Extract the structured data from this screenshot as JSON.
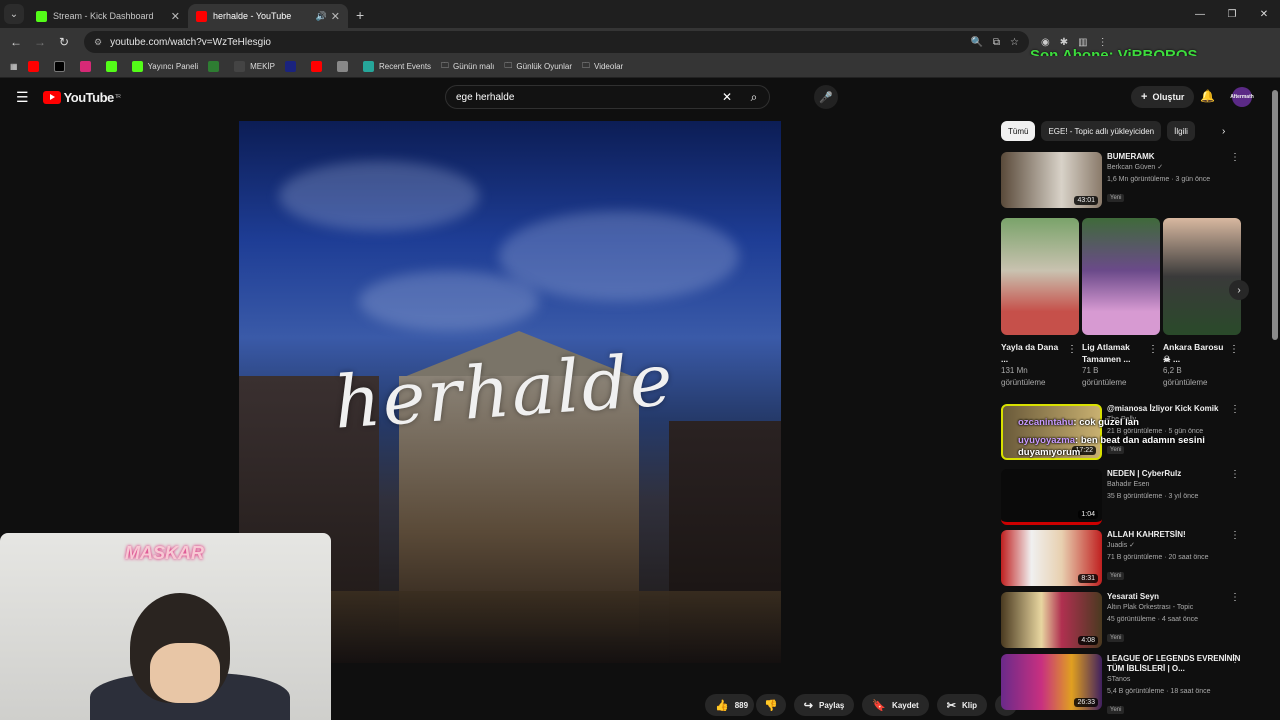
{
  "browser": {
    "tabs": [
      {
        "title": "Stream - Kick Dashboard",
        "icon_color": "#53fc18"
      },
      {
        "title": "herhalde - YouTube",
        "icon_color": "#ff0000"
      }
    ],
    "url": "youtube.com/watch?v=WzTeHlesgio",
    "bookmarks": [
      "Yayıncı Paneli",
      "MEKİP",
      "Recent Events",
      "Günün malı",
      "Günlük Oyunlar",
      "Videolar"
    ]
  },
  "stream_overlay": {
    "last_sub": "Son Abone: ViRBOROS",
    "cam_label": "MASKAR"
  },
  "youtube": {
    "logo": "YouTube",
    "logo_region": "TR",
    "search_value": "ege herhalde",
    "create_label": "Oluştur",
    "avatar_label": "Aftermath",
    "video_title_text": "herhalde",
    "actions": {
      "likes": "889",
      "share": "Paylaş",
      "save": "Kaydet",
      "clip": "Klip"
    },
    "chips": [
      "Tümü",
      "EGE! - Topic adlı yükleyiciden",
      "İlgili"
    ],
    "recs": [
      {
        "title": "BUMERAMK",
        "channel": "Berkcan Güven ✓",
        "meta": "1,6 Mn görüntüleme · 3 gün önce",
        "badge": "Yeni",
        "duration": "43:01"
      },
      {
        "title": "@mianosa İzliyor Kick Komik",
        "channel": "The Pally",
        "meta": "21 B görüntüleme · 5 gün önce",
        "badge": "Yeni",
        "duration": "17:22"
      },
      {
        "title": "NEDEN | CyberRulz",
        "channel": "Bahadır Esen",
        "meta": "35 B görüntüleme · 3 yıl önce",
        "badge": "",
        "duration": "1:04"
      },
      {
        "title": "ALLAH KAHRETSİN!",
        "channel": "Juadis ✓",
        "meta": "71 B görüntüleme · 20 saat önce",
        "badge": "Yeni",
        "duration": "8:31"
      },
      {
        "title": "Yesarati Seyn",
        "channel": "Altın Plak Orkestrası - Topic",
        "meta": "45 görüntüleme · 4 saat önce",
        "badge": "Yeni",
        "duration": "4:08"
      },
      {
        "title": "LEAGUE OF LEGENDS EVRENİNİN TÜM İBLİSLERİ | O...",
        "channel": "STanos",
        "meta": "5,4 B görüntüleme · 18 saat önce",
        "badge": "Yeni",
        "duration": "26:33"
      }
    ],
    "shorts": [
      {
        "title": "Yayla da Dana ...",
        "views": "131 Mn görüntüleme"
      },
      {
        "title": "Lig Atlamak Tamamen ...",
        "views": "71 B görüntüleme"
      },
      {
        "title": "Ankara Barosu ☠ ...",
        "views": "6,2 B görüntüleme"
      }
    ],
    "chat": [
      {
        "user": "ozcanintahu",
        "msg": ": cok güzel lan"
      },
      {
        "user": "uyuyoyazma",
        "msg": ": ben beat dan adamın sesini duyamıyorum"
      }
    ]
  }
}
